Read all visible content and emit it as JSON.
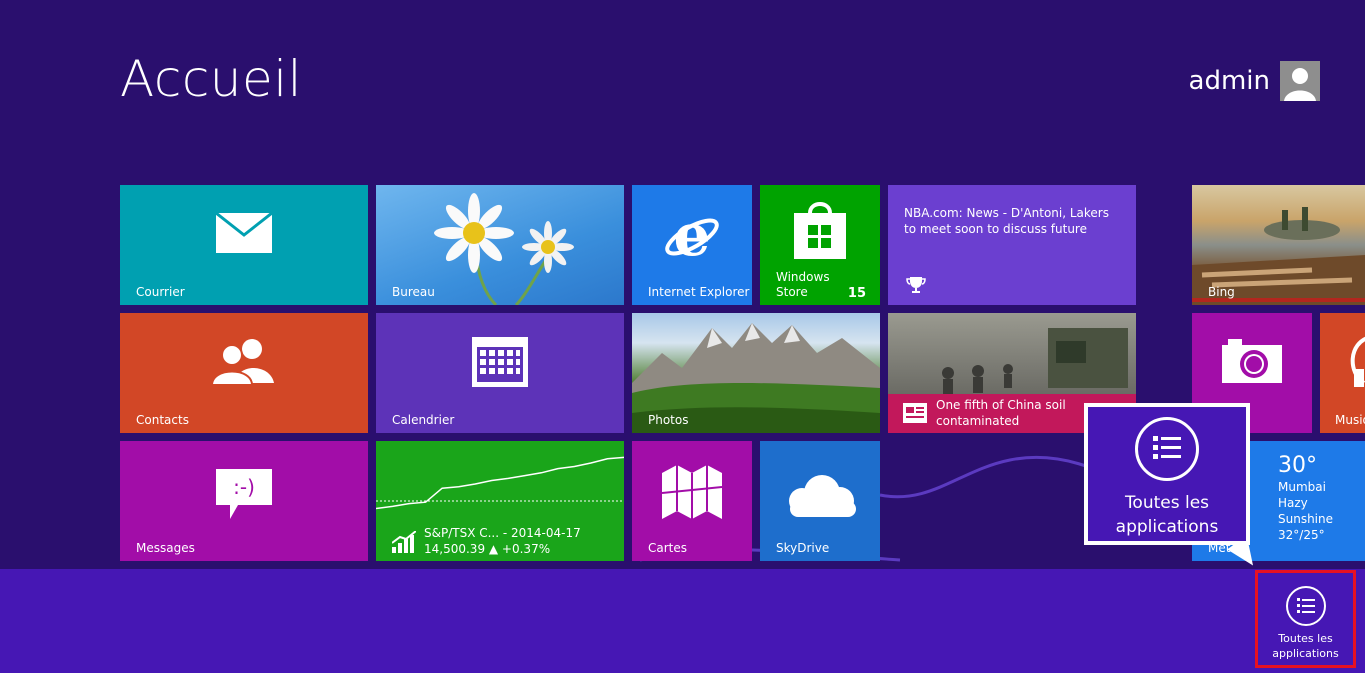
{
  "start": {
    "title": "Accueil",
    "user": "admin"
  },
  "tiles": {
    "courrier": {
      "label": "Courrier",
      "color": "#00a0b1"
    },
    "bureau": {
      "label": "Bureau"
    },
    "ie": {
      "label": "Internet Explorer",
      "color": "#1e7ae8"
    },
    "store": {
      "label_line1": "Windows",
      "label_line2": "Store",
      "badge": "15",
      "color": "#00a300"
    },
    "nba": {
      "text": "NBA.com: News - D'Antoni, Lakers to meet soon to discuss future",
      "color": "#6b3fd0"
    },
    "bing": {
      "label": "Bing"
    },
    "contacts": {
      "label": "Contacts",
      "color": "#d24726"
    },
    "calendrier": {
      "label": "Calendrier",
      "color": "#5d33b8"
    },
    "photos": {
      "label": "Photos"
    },
    "news": {
      "text": "One fifth of China soil contaminated",
      "color": "#c2185b"
    },
    "camera": {
      "color": "#a20da8"
    },
    "musique": {
      "label": "Musiq",
      "color": "#d24726"
    },
    "messages": {
      "label": "Messages",
      "color": "#a20da8"
    },
    "finance": {
      "line1": "S&P/TSX C... - 2014-04-17",
      "line2": "14,500.39 ▲ +0.37%",
      "color": "#1aa51a",
      "chart_trend": [
        0.15,
        0.18,
        0.22,
        0.24,
        0.44,
        0.46,
        0.5,
        0.55,
        0.58,
        0.62,
        0.66,
        0.72,
        0.75,
        0.8,
        0.86,
        0.88
      ]
    },
    "cartes": {
      "label": "Cartes",
      "color": "#a20da8"
    },
    "skydrive": {
      "label": "SkyDrive",
      "color": "#1e6ecc"
    },
    "meteo": {
      "temp": "30°",
      "city": "Mumbai",
      "condition": "Hazy Sunshine",
      "range": "32°/25°",
      "label": "Mete",
      "color": "#1e7ae8"
    }
  },
  "appbar": {
    "allapps_line1": "Toutes les",
    "allapps_line2": "applications"
  },
  "callout": {
    "line1": "Toutes les",
    "line2": "applications"
  }
}
